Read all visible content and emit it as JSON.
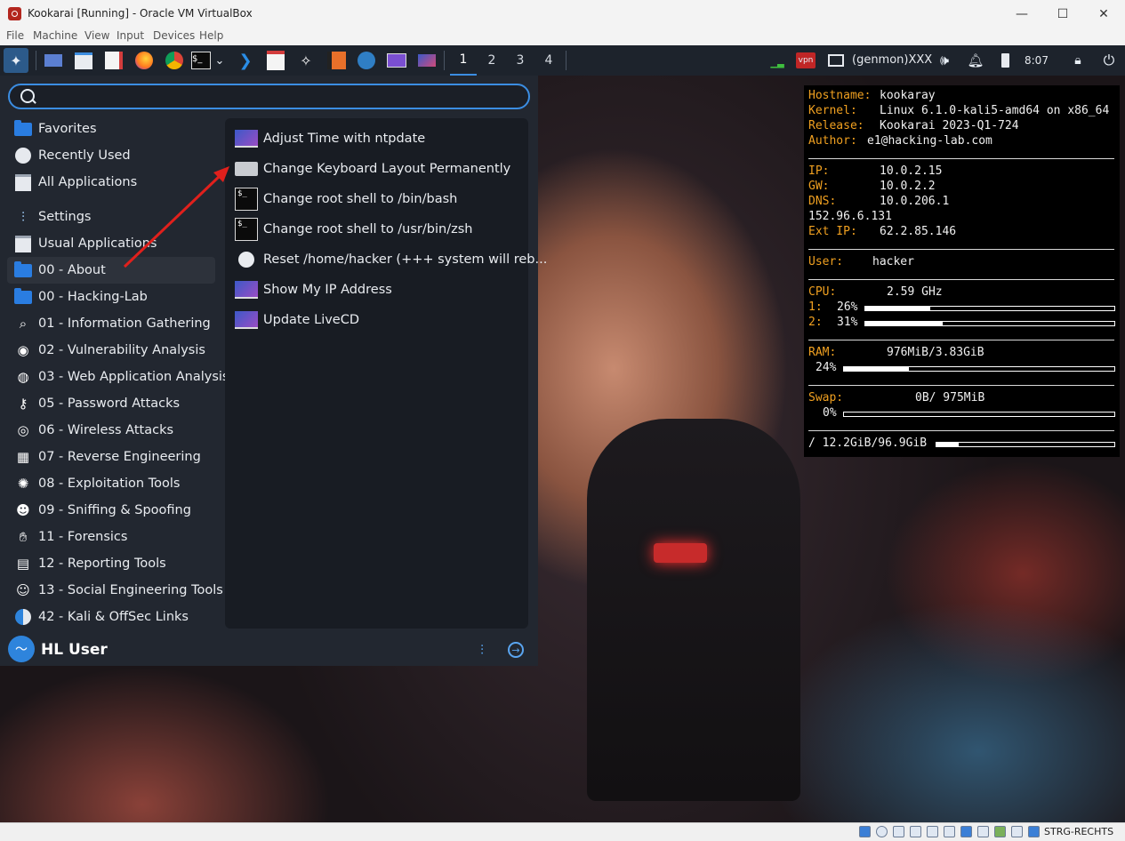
{
  "window": {
    "title": "Kookarai [Running] - Oracle VM VirtualBox",
    "min": "—",
    "max": "☐",
    "close": "✕"
  },
  "menubar": [
    "File",
    "Machine",
    "View",
    "Input",
    "Devices",
    "Help"
  ],
  "panel": {
    "workspaces": [
      "1",
      "2",
      "3",
      "4"
    ],
    "active_workspace": "1",
    "genmon": "(genmon)XXX",
    "vpn_label": "vpn",
    "clock": "8:07"
  },
  "menu": {
    "search_placeholder": "",
    "categories": [
      {
        "label": "Favorites",
        "icon": "star-folder-icon"
      },
      {
        "label": "Recently Used",
        "icon": "clock-icon"
      },
      {
        "label": "All Applications",
        "icon": "applications-icon"
      },
      {
        "label": "Settings",
        "icon": "settings-sliders-icon"
      },
      {
        "label": "Usual Applications",
        "icon": "applications-icon"
      },
      {
        "label": "00 - About",
        "icon": "folder-icon",
        "selected": true
      },
      {
        "label": "00 - Hacking-Lab",
        "icon": "folder-icon"
      },
      {
        "label": "01 - Information Gathering",
        "icon": "magnifier-icon"
      },
      {
        "label": "02 - Vulnerability Analysis",
        "icon": "shield-icon"
      },
      {
        "label": "03 - Web Application Analysis",
        "icon": "globe-icon"
      },
      {
        "label": "05 - Password Attacks",
        "icon": "key-icon"
      },
      {
        "label": "06 - Wireless Attacks",
        "icon": "wifi-icon"
      },
      {
        "label": "07 - Reverse Engineering",
        "icon": "grid-icon"
      },
      {
        "label": "08 - Exploitation Tools",
        "icon": "burst-icon"
      },
      {
        "label": "09 - Sniffing & Spoofing",
        "icon": "spy-icon"
      },
      {
        "label": "11 - Forensics",
        "icon": "hand-icon"
      },
      {
        "label": "12 - Reporting Tools",
        "icon": "document-icon"
      },
      {
        "label": "13 - Social Engineering Tools",
        "icon": "person-icon"
      },
      {
        "label": "42 - Kali & OffSec Links",
        "icon": "kali-links-icon"
      }
    ],
    "apps": [
      {
        "label": "Adjust Time with ntpdate",
        "icon": "screen"
      },
      {
        "label": "Change Keyboard Layout Permanently",
        "icon": "keyboard"
      },
      {
        "label": "Change root shell to /bin/bash",
        "icon": "terminal"
      },
      {
        "label": "Change root shell to /usr/bin/zsh",
        "icon": "terminal"
      },
      {
        "label": "Reset /home/hacker (+++ system will reb...",
        "icon": "reset"
      },
      {
        "label": "Show My IP Address",
        "icon": "screen"
      },
      {
        "label": "Update LiveCD",
        "icon": "screen"
      }
    ],
    "user": "HL User",
    "avatar_glyph": "〜"
  },
  "conky": {
    "hostname_key": "Hostname:",
    "hostname": "kookaray",
    "kernel_key": "Kernel:",
    "kernel": "Linux 6.1.0-kali5-amd64 on x86_64",
    "release_key": "Release:",
    "release": "Kookarai 2023-Q1-724",
    "author_key": "Author:",
    "author": "e1@hacking-lab.com",
    "ip_key": "IP:",
    "ip": "10.0.2.15",
    "gw_key": "GW:",
    "gw": "10.0.2.2",
    "dns_key": "DNS:",
    "dns": "10.0.206.1",
    "dns2": "152.96.6.131",
    "extip_key": "Ext IP:",
    "extip": "62.2.85.146",
    "user_key": "User:",
    "user": "hacker",
    "cpu_key": "CPU:",
    "cpu": "2.59 GHz",
    "cpu1_key": "1:",
    "cpu1": "26%",
    "cpu2_key": "2:",
    "cpu2": "31%",
    "ram_key": "RAM:",
    "ram": "976MiB/3.83GiB",
    "ram_pct": "24%",
    "swap_key": "Swap:",
    "swap": "0B/ 975MiB",
    "swap_pct": "0%",
    "disk": "/ 12.2GiB/96.9GiB",
    "levels": {
      "cpu1": 0.26,
      "cpu2": 0.31,
      "ram": 0.24,
      "swap": 0.0,
      "disk": 0.126
    }
  },
  "statusbar": {
    "host_key": "STRG-RECHTS"
  },
  "colors": {
    "accent": "#3b8de2",
    "conky_key": "#f0a020",
    "annotation": "#e0201c"
  }
}
